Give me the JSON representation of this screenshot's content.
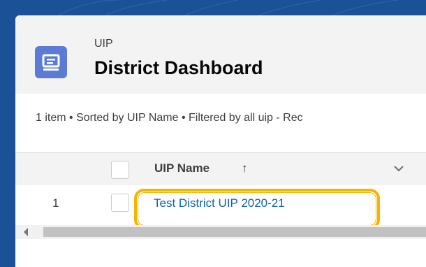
{
  "header": {
    "object_label": "UIP",
    "title": "District Dashboard",
    "icon": "record-icon"
  },
  "list_meta": "1 item • Sorted by UIP Name • Filtered by all uip - Rec",
  "table": {
    "columns": [
      {
        "label": "UIP Name",
        "sort": "ascending",
        "sort_icon": "↑",
        "menu_icon": "chevron-down-icon"
      }
    ],
    "rows": [
      {
        "number": "1",
        "uip_name": "Test District UIP 2020-21"
      }
    ]
  },
  "colors": {
    "background": "#1b5297",
    "icon_bg": "#5b7bd5",
    "link": "#0b63b3",
    "highlight": "#f4b400"
  }
}
